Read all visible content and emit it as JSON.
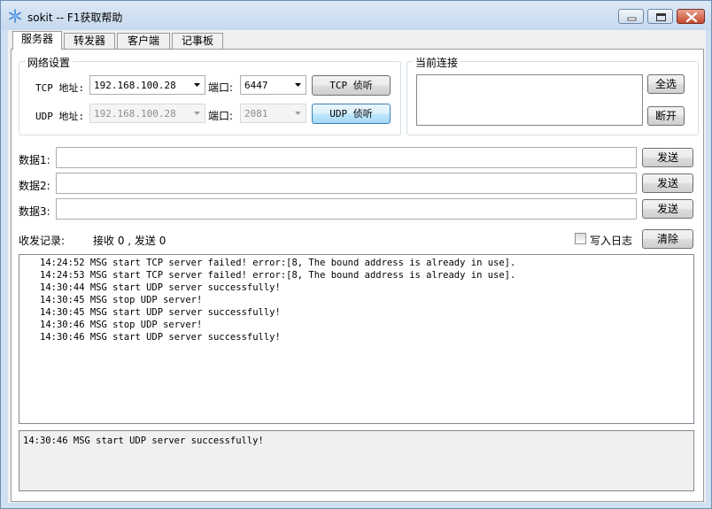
{
  "window": {
    "title": "sokit -- F1获取帮助",
    "app_icon": "snowflake-icon",
    "controls": [
      "minimize-icon",
      "maximize-icon",
      "close-icon"
    ]
  },
  "tabs": [
    {
      "label": "服务器",
      "active": true
    },
    {
      "label": "转发器",
      "active": false
    },
    {
      "label": "客户端",
      "active": false
    },
    {
      "label": "记事板",
      "active": false
    }
  ],
  "network": {
    "title": "网络设置",
    "tcp_label": "TCP 地址:",
    "tcp_address": "192.168.100.28",
    "tcp_port_label": "端口:",
    "tcp_port": "6447",
    "tcp_button": "TCP 侦听",
    "udp_label": "UDP 地址:",
    "udp_address": "192.168.100.28",
    "udp_port_label": "端口:",
    "udp_port": "2081",
    "udp_button": "UDP 侦听"
  },
  "connections": {
    "title": "当前连接",
    "select_all": "全选",
    "disconnect": "断开"
  },
  "data_rows": [
    {
      "label": "数据1:",
      "value": "",
      "send": "发送"
    },
    {
      "label": "数据2:",
      "value": "",
      "send": "发送"
    },
    {
      "label": "数据3:",
      "value": "",
      "send": "发送"
    }
  ],
  "records": {
    "label": "收发记录:",
    "stats": "接收 0 , 发送 0",
    "write_log_label": "写入日志",
    "write_log_checked": false,
    "clear": "清除"
  },
  "log_lines": [
    "14:24:52 MSG start TCP server failed! error:[8, The bound address is already in use].",
    "14:24:53 MSG start TCP server failed! error:[8, The bound address is already in use].",
    "14:30:44 MSG start UDP server successfully!",
    "14:30:45 MSG stop UDP server!",
    "14:30:45 MSG start UDP server successfully!",
    "14:30:46 MSG stop UDP server!",
    "14:30:46 MSG start UDP server successfully!"
  ],
  "status_line": "14:30:46 MSG start UDP server successfully!",
  "colors": {
    "titlebar": "#cfe0f2",
    "close_button": "#c7492f",
    "default_button": "#bee6fd"
  }
}
